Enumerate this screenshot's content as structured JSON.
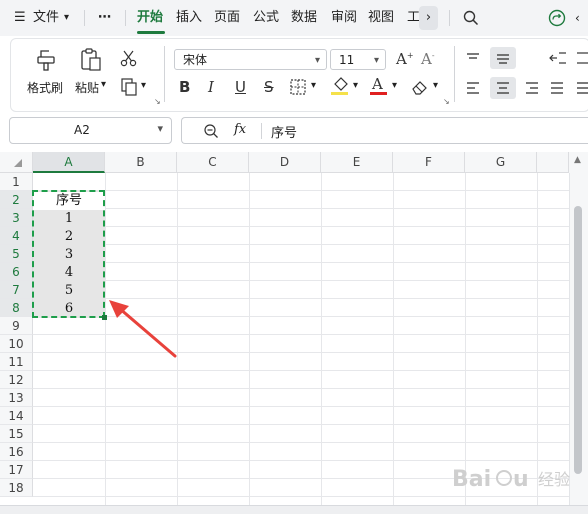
{
  "menu": {
    "items": [
      "文件",
      "⋯",
      "开始",
      "插入",
      "页面",
      "公式",
      "数据",
      "审阅",
      "视图",
      "工"
    ],
    "active": "开始"
  },
  "ribbon": {
    "format_painter": "格式刷",
    "paste": "粘贴",
    "font_name": "宋体",
    "font_size": "11",
    "bold": "B",
    "italic": "I",
    "underline": "U",
    "strike": "S",
    "font_color_glyph": "A",
    "grow_font": "A⁺",
    "shrink_font": "A⁻",
    "fill_color": "#f5e14a",
    "font_color": "#e02020"
  },
  "formula_bar": {
    "name_box": "A2",
    "fx": "fx",
    "content": "序号"
  },
  "columns": [
    "A",
    "B",
    "C",
    "D",
    "E",
    "F",
    "G"
  ],
  "rows": [
    "1",
    "2",
    "3",
    "4",
    "5",
    "6",
    "7",
    "8",
    "9",
    "10",
    "11",
    "12",
    "13",
    "14",
    "15",
    "16",
    "17",
    "18"
  ],
  "cells": {
    "A2": "序号",
    "A3": "1",
    "A4": "2",
    "A5": "3",
    "A6": "4",
    "A7": "5",
    "A8": "6"
  },
  "watermark": "Baidu 经验",
  "colors": {
    "accent": "#1e7a3e",
    "arrow": "#e8423b",
    "selection": "#e6e6e6"
  }
}
